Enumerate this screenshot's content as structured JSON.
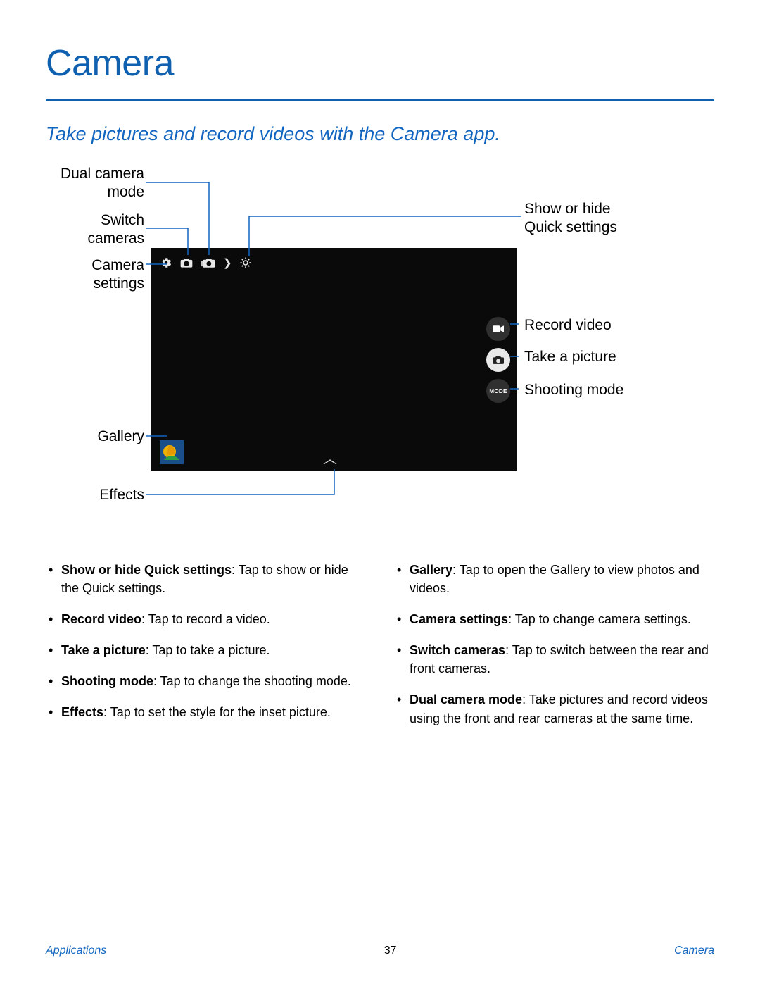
{
  "title": "Camera",
  "subtitle": "Take pictures and record videos with the Camera app.",
  "callouts": {
    "dual_camera_mode": "Dual camera\nmode",
    "switch_cameras": "Switch\ncameras",
    "camera_settings": "Camera\nsettings",
    "gallery": "Gallery",
    "effects": "Effects",
    "show_hide_quick": "Show or hide\nQuick settings",
    "record_video": "Record video",
    "take_picture": "Take a picture",
    "shooting_mode": "Shooting mode"
  },
  "icons": {
    "settings": "gear-icon",
    "switch": "switch-camera-icon",
    "dual": "dual-camera-icon",
    "chevron_right": "chevron-right-icon",
    "quick": "brightness-icon",
    "record": "video-icon",
    "shutter": "camera-icon",
    "mode_label": "MODE",
    "effects_caret": "caret-up-icon"
  },
  "bullets_left": [
    {
      "term": "Show or hide Quick settings",
      "desc": ": Tap to show or hide the Quick settings."
    },
    {
      "term": "Record video",
      "desc": ": Tap to record a video."
    },
    {
      "term": "Take a picture",
      "desc": ": Tap to take a picture."
    },
    {
      "term": "Shooting mode",
      "desc": ": Tap to change the shooting mode."
    },
    {
      "term": "Effects",
      "desc": ": Tap to set the style for the inset picture."
    }
  ],
  "bullets_right": [
    {
      "term": "Gallery",
      "desc": ": Tap to open the Gallery to view photos and videos."
    },
    {
      "term": "Camera settings",
      "desc": ": Tap to change camera settings."
    },
    {
      "term": "Switch cameras",
      "desc": ": Tap to switch between the rear and front cameras."
    },
    {
      "term": "Dual camera mode",
      "desc": ": Take pictures and record videos using the front and rear cameras at the same time."
    }
  ],
  "footer": {
    "left": "Applications",
    "page": "37",
    "right": "Camera"
  }
}
